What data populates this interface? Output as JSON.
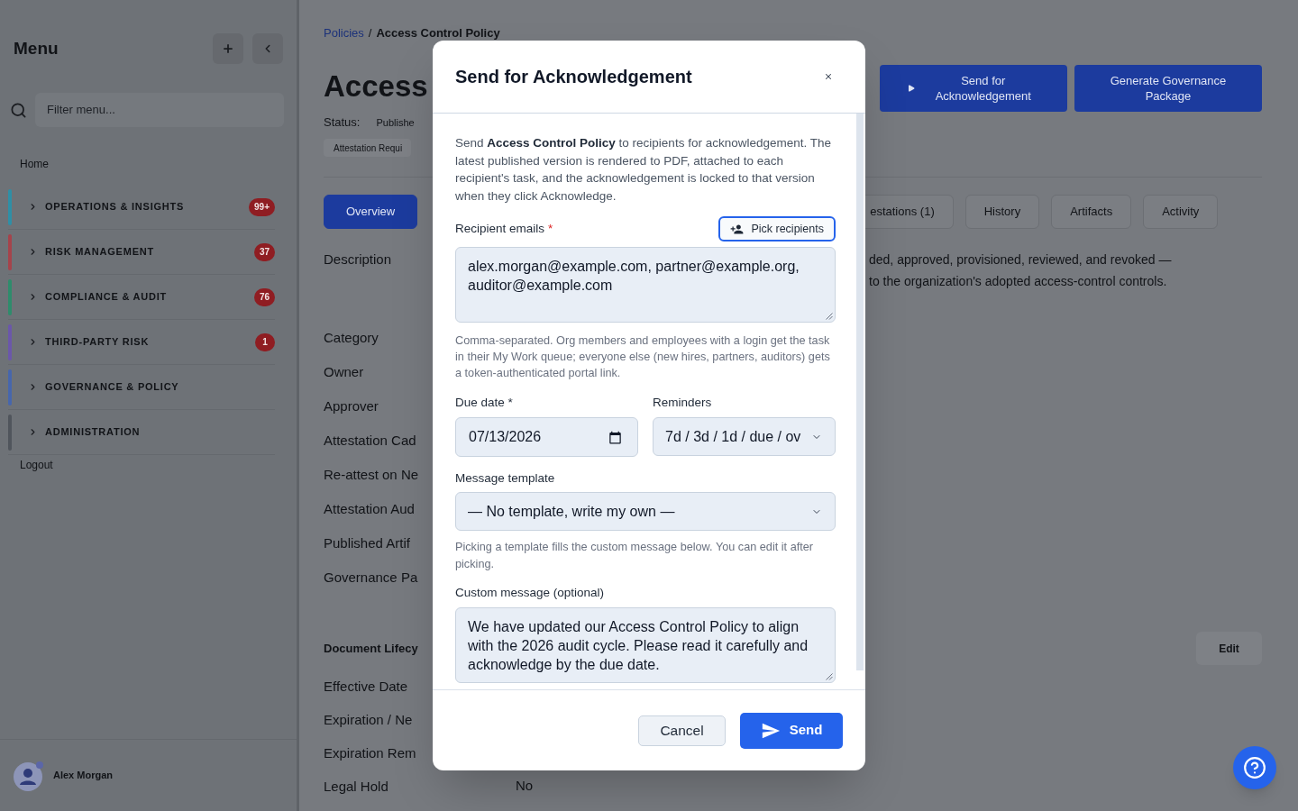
{
  "sidebar": {
    "title": "Menu",
    "search": {
      "placeholder": "Filter menu..."
    },
    "home": "Home",
    "sections": [
      {
        "label": "OPERATIONS & INSIGHTS",
        "badge": "99+",
        "color": "#2f8fa6"
      },
      {
        "label": "RISK MANAGEMENT",
        "badge": "37",
        "color": "#a5434b"
      },
      {
        "label": "COMPLIANCE & AUDIT",
        "badge": "76",
        "color": "#2f8c6c"
      },
      {
        "label": "THIRD-PARTY RISK",
        "badge": "1",
        "color": "#6b57aa"
      },
      {
        "label": "GOVERNANCE & POLICY",
        "color": "#4766ac"
      },
      {
        "label": "ADMINISTRATION",
        "color": "#50555c"
      }
    ],
    "logout": "Logout",
    "user": {
      "name": "Alex Morgan"
    }
  },
  "page": {
    "breadcrumb": {
      "items": [
        "Policies",
        "Access Control Policy"
      ],
      "separator": "/"
    },
    "title": "Access",
    "status": {
      "label": "Status:",
      "value": "Publishe"
    },
    "badge": "Attestation Requi",
    "actions": [
      {
        "label": "Send for Acknowledgement",
        "kind": "play"
      },
      {
        "label": "Generate Governance Package",
        "kind": "plain"
      }
    ],
    "tabs": [
      {
        "label": "Overview",
        "selected": true
      },
      {
        "label": "estations (1)",
        "selected": false
      },
      {
        "label": "History",
        "selected": false
      },
      {
        "label": "Artifacts",
        "selected": false
      },
      {
        "label": "Activity",
        "selected": false
      }
    ],
    "description": {
      "label": "Description",
      "lines": [
        "ded, approved, provisioned, reviewed, and revoked —",
        "to the organization's adopted access-control controls."
      ]
    },
    "fields": [
      {
        "label": "Category"
      },
      {
        "label": "Owner"
      },
      {
        "label": "Approver"
      },
      {
        "label": "Attestation Cad"
      },
      {
        "label": "Re-attest on Ne"
      },
      {
        "label": "Attestation Aud"
      },
      {
        "label": "Published Artif"
      },
      {
        "label": "Governance Pa"
      }
    ],
    "lifecycle": {
      "title": "Document Lifecy",
      "edit": "Edit",
      "fields": [
        {
          "label": "Effective Date"
        },
        {
          "label": "Expiration / Ne"
        },
        {
          "label": "Expiration Rem"
        },
        {
          "label": "Legal Hold",
          "value": "No"
        }
      ]
    }
  },
  "dialog": {
    "title": "Send for Acknowledgement",
    "intro": "Send **Access Control Policy** to recipients for acknowledgement. The latest published version is rendered to PDF, attached to each recipient's task, and the acknowledgement is locked to that version when they click Acknowledge.",
    "recipients": {
      "label": "Recipient emails",
      "required_mark": "*",
      "button": "Pick recipients",
      "value": "alex.morgan@example.com, partner@example.org, auditor@example.com",
      "hint": "Comma-separated. Org members and employees with a login get the task in their My Work queue; everyone else (new hires, partners, auditors) gets a token-authenticated portal link."
    },
    "due_date": {
      "label": "Due date *",
      "value": "07/13/2026"
    },
    "reminders": {
      "label": "Reminders",
      "value": "7d / 3d / 1d / due / ov"
    },
    "template": {
      "label": "Message template",
      "value": "— No template, write my own —",
      "hint": "Picking a template fills the custom message below. You can edit it after picking."
    },
    "message": {
      "label": "Custom message (optional)",
      "value": "We have updated our Access Control Policy to align with the 2026 audit cycle. Please read it carefully and acknowledge by the due date."
    },
    "buttons": {
      "cancel": "Cancel",
      "send": "Send"
    }
  }
}
